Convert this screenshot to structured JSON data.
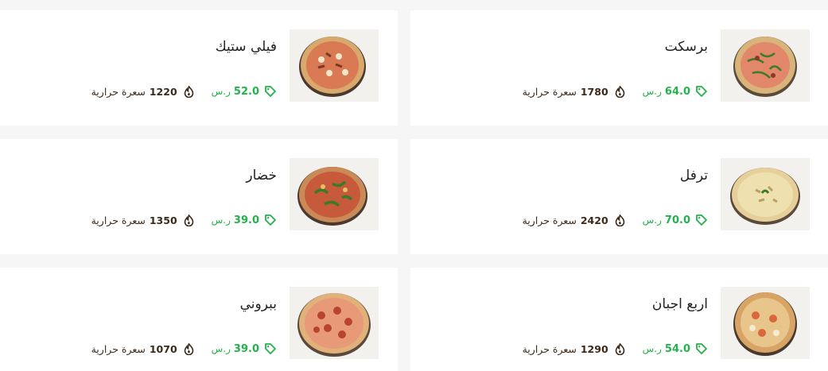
{
  "currency": "ر.س",
  "calorie_label": "سعرة حرارية",
  "items": [
    {
      "name": "برسكت",
      "price": "64.0",
      "calories": "1780"
    },
    {
      "name": "فيلي ستيك",
      "price": "52.0",
      "calories": "1220"
    },
    {
      "name": "ترفل",
      "price": "70.0",
      "calories": "2420"
    },
    {
      "name": "خضار",
      "price": "39.0",
      "calories": "1350"
    },
    {
      "name": "اربع اجبان",
      "price": "54.0",
      "calories": "1290"
    },
    {
      "name": "ببروني",
      "price": "39.0",
      "calories": "1070"
    }
  ],
  "icons": {
    "price": "tag-icon",
    "calories": "flame-icon"
  },
  "colors": {
    "price": "#23b24b",
    "calories": "#3b2a1a",
    "title": "#222222"
  }
}
